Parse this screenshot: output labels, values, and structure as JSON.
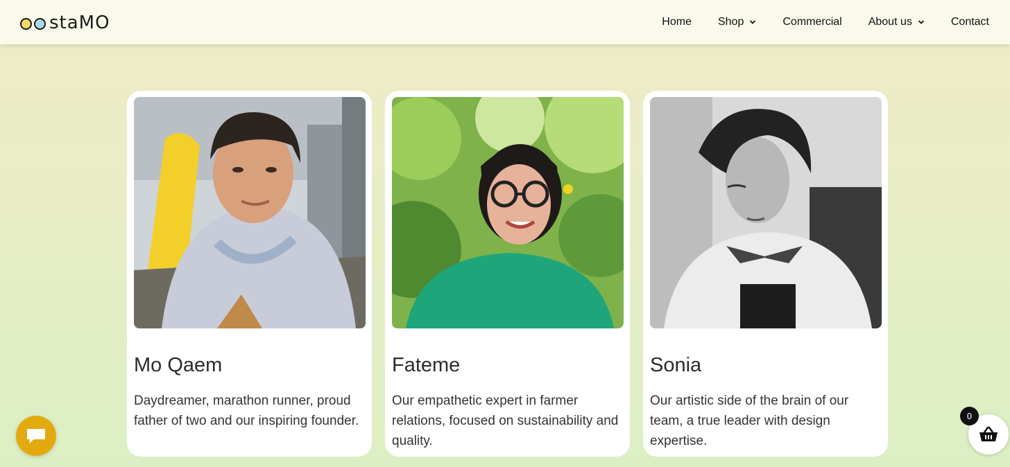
{
  "brand": {
    "logo_text": "stamo",
    "logo_text_display": "staMO"
  },
  "nav": {
    "items": [
      {
        "label": "Home",
        "dropdown": false
      },
      {
        "label": "Shop",
        "dropdown": true
      },
      {
        "label": "Commercial",
        "dropdown": false
      },
      {
        "label": "About us",
        "dropdown": true
      },
      {
        "label": "Contact",
        "dropdown": false
      }
    ]
  },
  "team": [
    {
      "name": "Mo Qaem",
      "description": "Daydreamer, marathon runner, proud father of two and our inspiring founder."
    },
    {
      "name": "Fateme",
      "description": "Our empathetic expert in farmer relations, focused on sustainability and quality."
    },
    {
      "name": "Sonia",
      "description": "Our artistic side of the brain of our team, a true leader with design expertise."
    }
  ],
  "cart": {
    "count": "0",
    "icon": "basket-icon"
  },
  "chat": {
    "icon": "chat-bubble-icon"
  },
  "colors": {
    "chat_button": "#e3aa10",
    "header_bg": "#fafaeb",
    "logo_yellow": "#f6d867",
    "logo_blue": "#a9dcf2"
  }
}
